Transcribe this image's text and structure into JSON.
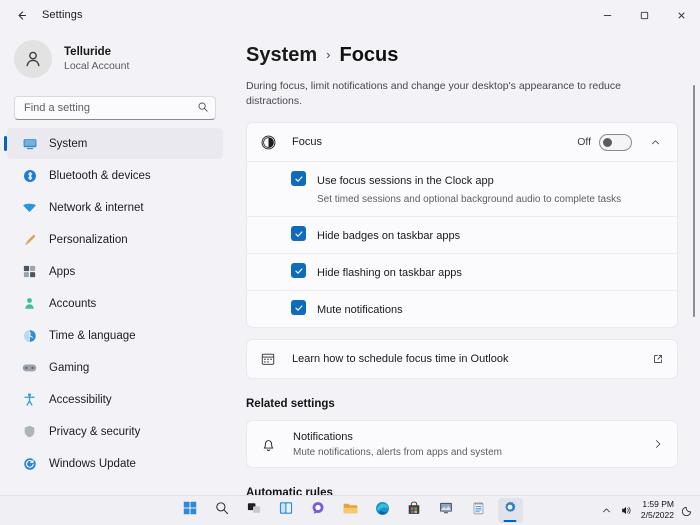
{
  "window": {
    "title": "Settings",
    "back_icon": "back-arrow-icon",
    "minimize_label": "—",
    "maximize_label": "□",
    "close_label": "✕"
  },
  "sidebar": {
    "account": {
      "name": "Telluride",
      "type": "Local Account",
      "avatar_icon": "person-avatar-icon"
    },
    "search": {
      "placeholder": "Find a setting",
      "value": "",
      "icon": "search-icon"
    },
    "items": [
      {
        "label": "System",
        "icon": "monitor-icon",
        "active": true
      },
      {
        "label": "Bluetooth & devices",
        "icon": "bluetooth-icon",
        "active": false
      },
      {
        "label": "Network & internet",
        "icon": "wifi-icon",
        "active": false
      },
      {
        "label": "Personalization",
        "icon": "paintbrush-icon",
        "active": false
      },
      {
        "label": "Apps",
        "icon": "apps-grid-icon",
        "active": false
      },
      {
        "label": "Accounts",
        "icon": "person-icon",
        "active": false
      },
      {
        "label": "Time & language",
        "icon": "clock-globe-icon",
        "active": false
      },
      {
        "label": "Gaming",
        "icon": "gamepad-icon",
        "active": false
      },
      {
        "label": "Accessibility",
        "icon": "accessibility-person-icon",
        "active": false
      },
      {
        "label": "Privacy & security",
        "icon": "shield-icon",
        "active": false
      },
      {
        "label": "Windows Update",
        "icon": "update-refresh-icon",
        "active": false
      }
    ]
  },
  "main": {
    "breadcrumb": {
      "parent": "System",
      "separator": "›",
      "current": "Focus"
    },
    "description": "During focus, limit notifications and change your desktop's appearance to reduce distractions.",
    "focus_card": {
      "icon": "focus-moon-icon",
      "label": "Focus",
      "toggle_state": "Off",
      "toggle_on": false,
      "expanded": true,
      "expand_icon": "chevron-up-icon",
      "options": [
        {
          "label": "Use focus sessions in the Clock app",
          "sublabel": "Set timed sessions and optional background audio to complete tasks",
          "checked": true
        },
        {
          "label": "Hide badges on taskbar apps",
          "sublabel": "",
          "checked": true
        },
        {
          "label": "Hide flashing on taskbar apps",
          "sublabel": "",
          "checked": true
        },
        {
          "label": "Mute notifications",
          "sublabel": "",
          "checked": true
        }
      ]
    },
    "outlook_link": {
      "icon": "calendar-icon",
      "label": "Learn how to schedule focus time in Outlook",
      "end_icon": "external-link-icon"
    },
    "related_settings_heading": "Related settings",
    "notifications_row": {
      "icon": "bell-icon",
      "title": "Notifications",
      "subtitle": "Mute notifications, alerts from apps and system",
      "end_icon": "chevron-right-icon"
    },
    "automatic_rules_heading": "Automatic rules"
  },
  "taskbar": {
    "items": [
      {
        "name": "start-button",
        "icon": "windows-logo-icon",
        "active": false
      },
      {
        "name": "search-button",
        "icon": "search-icon",
        "active": false
      },
      {
        "name": "task-view-button",
        "icon": "task-view-icon",
        "active": false
      },
      {
        "name": "widgets-button",
        "icon": "widgets-icon",
        "active": false
      },
      {
        "name": "chat-button",
        "icon": "chat-bubble-icon",
        "active": false
      },
      {
        "name": "file-explorer-button",
        "icon": "folder-icon",
        "active": false
      },
      {
        "name": "edge-button",
        "icon": "edge-browser-icon",
        "active": false
      },
      {
        "name": "microsoft-store-button",
        "icon": "store-bag-icon",
        "active": false
      },
      {
        "name": "snipping-tool-button",
        "icon": "snipping-tool-icon",
        "active": false
      },
      {
        "name": "notepad-button",
        "icon": "notepad-icon",
        "active": false
      },
      {
        "name": "settings-button",
        "icon": "gear-icon",
        "active": true
      }
    ],
    "tray": {
      "overflow_icon": "chevron-up-icon",
      "volume_icon": "speaker-icon",
      "time": "1:59 PM",
      "date": "2/5/2022",
      "focus_icon": "moon-icon"
    }
  },
  "colors": {
    "accent": "#0067C0",
    "checkbox": "#0F6CBD",
    "page_bg": "#F2F2F7",
    "card_bg": "#FBFBFD"
  }
}
